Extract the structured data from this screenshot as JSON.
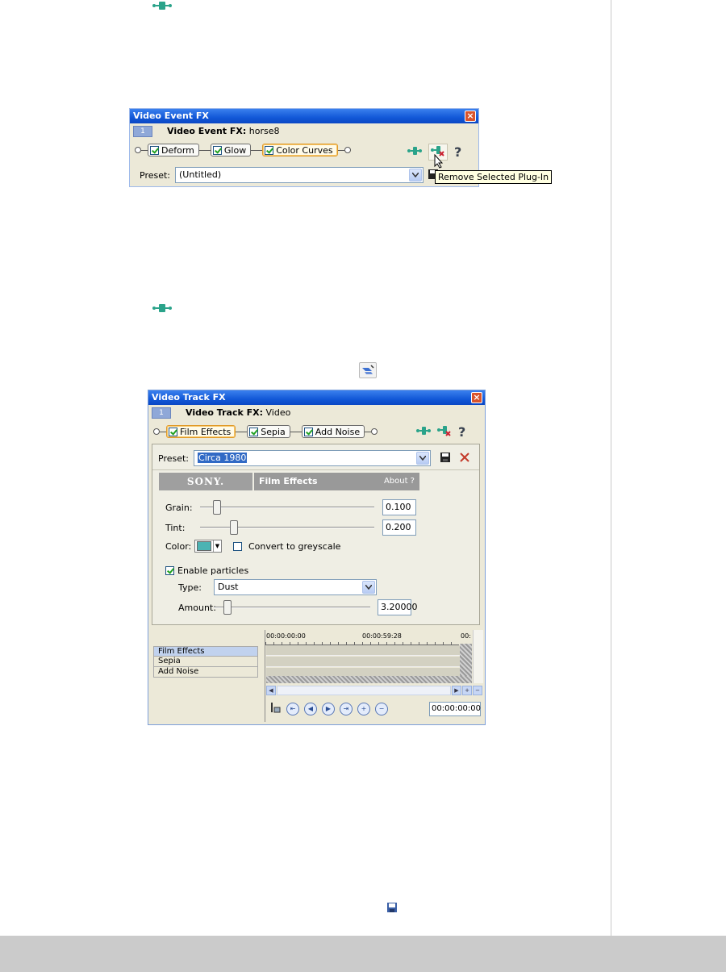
{
  "win1": {
    "title": "Video Event FX",
    "tab_number": "1",
    "fx_prefix": "Video Event FX:",
    "fx_name": "horse8",
    "plugins": [
      "Deform",
      "Glow",
      "Color Curves"
    ],
    "preset_label": "Preset:",
    "preset_value": "(Untitled)",
    "tooltip": "Remove Selected Plug-In"
  },
  "win2": {
    "title": "Video Track FX",
    "tab_number": "1",
    "fx_prefix": "Video Track FX:",
    "fx_name": "Video",
    "plugins": [
      "Film Effects",
      "Sepia",
      "Add Noise"
    ],
    "preset_label": "Preset:",
    "preset_value": "Circa 1980",
    "sony_logo": "SONY.",
    "plugin_title": "Film Effects",
    "about": "About ?",
    "grain_label": "Grain:",
    "grain_value": "0.100",
    "grain_level": 0.1,
    "tint_label": "Tint:",
    "tint_value": "0.200",
    "tint_level": 0.2,
    "color_label": "Color:",
    "color_swatch": "#4cb3b3",
    "greyscale_label": "Convert to greyscale",
    "particles_label": "Enable particles",
    "type_label": "Type:",
    "type_value": "Dust",
    "amount_label": "Amount:",
    "amount_value": "3.20000",
    "tracks": [
      "Film Effects",
      "Sepia",
      "Add Noise"
    ],
    "ruler_start": "00:00:00:00",
    "ruler_mid": "00:00:59:28",
    "ruler_end": "00:",
    "time": "00:00:00:00"
  }
}
